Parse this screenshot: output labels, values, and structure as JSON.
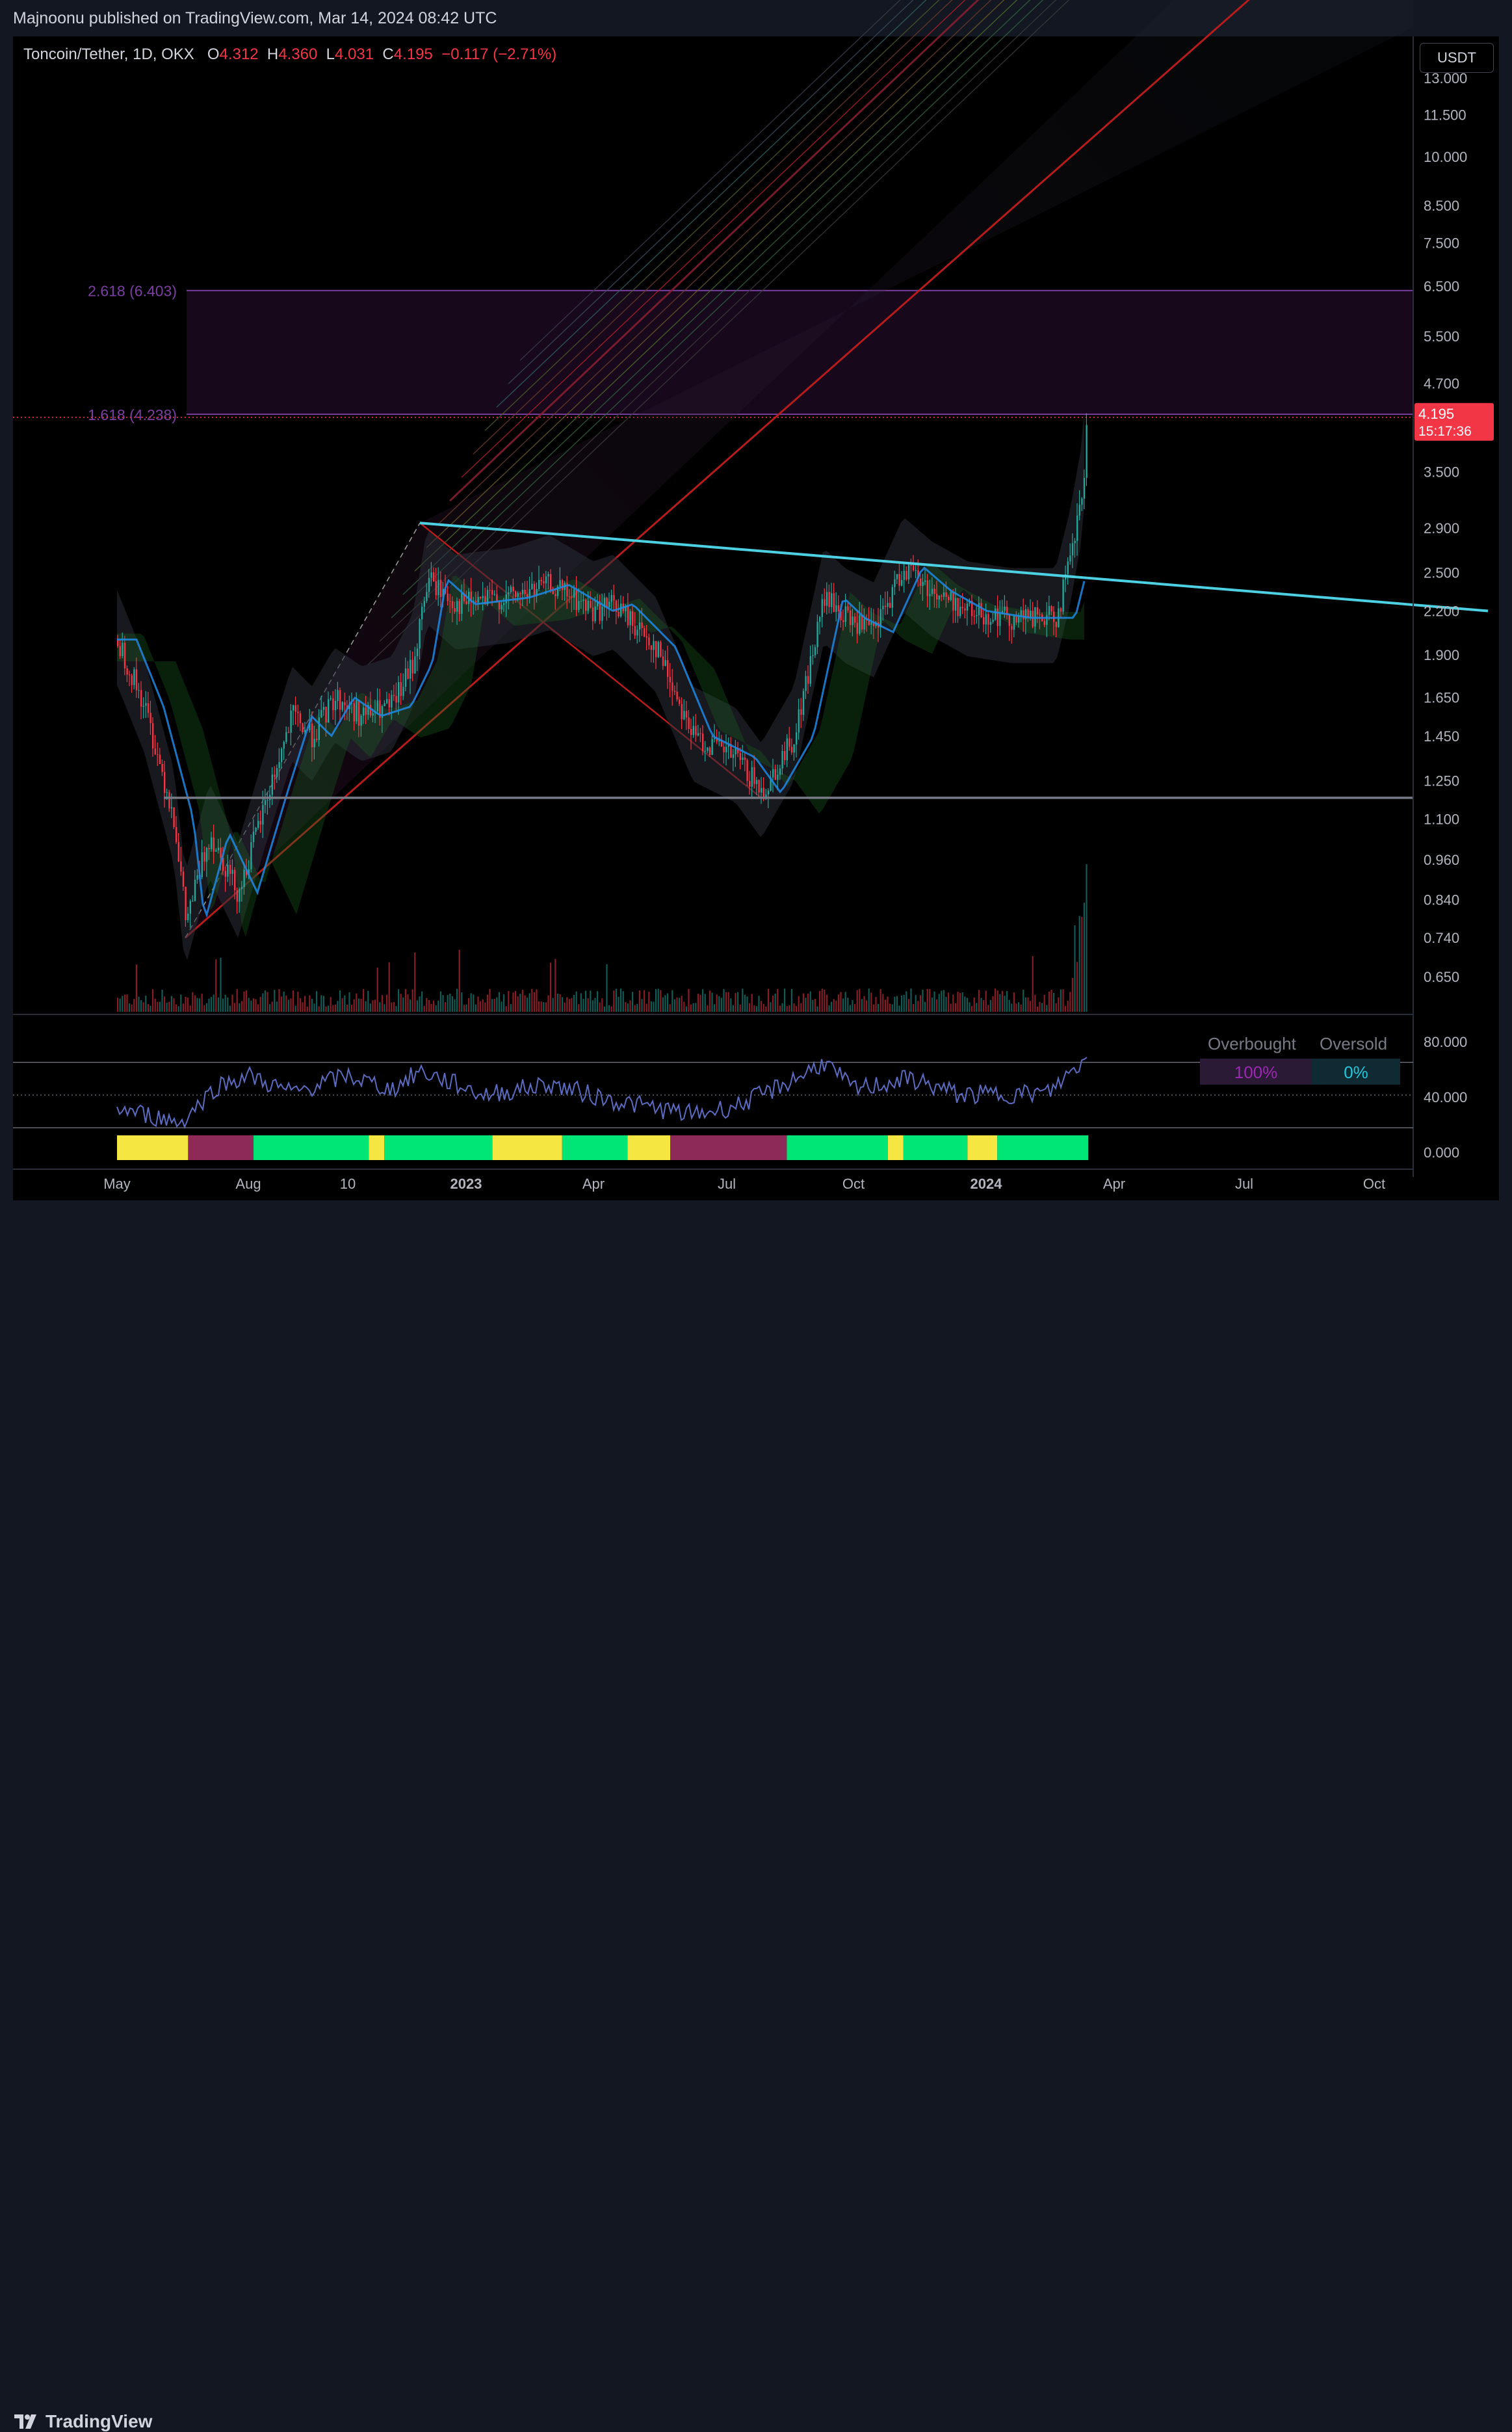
{
  "publisher": "Majnoonu published on TradingView.com, Mar 14, 2024 08:42 UTC",
  "symbol": {
    "name": "Toncoin/Tether, 1D, OKX",
    "o_label": "O",
    "o": "4.312",
    "h_label": "H",
    "h": "4.360",
    "l_label": "L",
    "l": "4.031",
    "c_label": "C",
    "c": "4.195",
    "change": "−0.117 (−2.71%)"
  },
  "currency_button": "USDT",
  "last_price": {
    "value": "4.195",
    "countdown": "15:17:36"
  },
  "fib_levels": [
    {
      "label": "2.618 (6.403)",
      "value": 6.403
    },
    {
      "label": "1.618 (4.238)",
      "value": 4.238
    }
  ],
  "indicator": {
    "overbought_label": "Overbought",
    "oversold_label": "Oversold",
    "overbought_value": "100%",
    "oversold_value": "0%",
    "axis_ticks": [
      "80.000",
      "40.000",
      "0.000"
    ]
  },
  "colors": {
    "up": "#26a69a",
    "down": "#f23645",
    "trendline": "#4dd0e1",
    "fib": "#7b3fa0",
    "rsi": "#7e57c2"
  },
  "chart_data": {
    "type": "candlestick",
    "scale": "log",
    "y_ticks": [
      "13.000",
      "11.500",
      "10.000",
      "8.500",
      "7.500",
      "6.500",
      "5.500",
      "4.700",
      "3.500",
      "2.900",
      "2.500",
      "2.200",
      "1.900",
      "1.650",
      "1.450",
      "1.250",
      "1.100",
      "0.960",
      "0.840",
      "0.740",
      "0.650"
    ],
    "x_ticks": [
      "May",
      "Aug",
      "10",
      "2023",
      "Apr",
      "Jul",
      "Oct",
      "2024",
      "Apr",
      "Jul",
      "Oct"
    ],
    "x_ticks_bold": [
      "2023",
      "2024"
    ],
    "price_path": [
      [
        "2022-05-01",
        2.0
      ],
      [
        "2022-05-20",
        1.6
      ],
      [
        "2022-06-10",
        1.1
      ],
      [
        "2022-06-18",
        0.78
      ],
      [
        "2022-07-05",
        1.05
      ],
      [
        "2022-07-25",
        0.86
      ],
      [
        "2022-08-15",
        1.2
      ],
      [
        "2022-09-01",
        1.55
      ],
      [
        "2022-09-15",
        1.45
      ],
      [
        "2022-10-01",
        1.65
      ],
      [
        "2022-10-20",
        1.55
      ],
      [
        "2022-11-10",
        1.6
      ],
      [
        "2022-11-25",
        1.85
      ],
      [
        "2022-12-05",
        2.45
      ],
      [
        "2022-12-25",
        2.25
      ],
      [
        "2023-02-01",
        2.3
      ],
      [
        "2023-03-01",
        2.4
      ],
      [
        "2023-04-01",
        2.2
      ],
      [
        "2023-04-15",
        2.25
      ],
      [
        "2023-05-15",
        1.95
      ],
      [
        "2023-06-10",
        1.45
      ],
      [
        "2023-07-10",
        1.35
      ],
      [
        "2023-07-28",
        1.2
      ],
      [
        "2023-08-20",
        1.45
      ],
      [
        "2023-09-10",
        2.3
      ],
      [
        "2023-09-25",
        2.15
      ],
      [
        "2023-10-15",
        2.05
      ],
      [
        "2023-11-05",
        2.55
      ],
      [
        "2023-11-25",
        2.35
      ],
      [
        "2023-12-20",
        2.2
      ],
      [
        "2024-01-20",
        2.15
      ],
      [
        "2024-02-20",
        2.15
      ],
      [
        "2024-03-01",
        2.6
      ],
      [
        "2024-03-10",
        3.3
      ],
      [
        "2024-03-13",
        4.195
      ]
    ],
    "trendline": [
      [
        "2022-11-30",
        2.95
      ],
      [
        "2024-12-20",
        2.2
      ]
    ],
    "support_level": 1.18,
    "rsi_range": [
      0,
      100
    ],
    "rsi_path": [
      [
        "2022-05-01",
        38
      ],
      [
        "2022-06-15",
        25
      ],
      [
        "2022-07-10",
        58
      ],
      [
        "2022-08-01",
        68
      ],
      [
        "2022-09-01",
        52
      ],
      [
        "2022-10-10",
        68
      ],
      [
        "2022-11-10",
        55
      ],
      [
        "2022-11-30",
        72
      ],
      [
        "2023-01-15",
        50
      ],
      [
        "2023-03-01",
        60
      ],
      [
        "2023-04-15",
        45
      ],
      [
        "2023-06-10",
        32
      ],
      [
        "2023-07-10",
        40
      ],
      [
        "2023-08-01",
        52
      ],
      [
        "2023-08-25",
        68
      ],
      [
        "2023-09-10",
        80
      ],
      [
        "2023-10-01",
        55
      ],
      [
        "2023-11-10",
        65
      ],
      [
        "2023-12-15",
        50
      ],
      [
        "2024-02-15",
        52
      ],
      [
        "2024-03-05",
        75
      ],
      [
        "2024-03-13",
        83
      ]
    ],
    "heatmap_segments": [
      [
        "2022-05-01",
        "2022-06-20",
        "#f5e642"
      ],
      [
        "2022-06-20",
        "2022-08-05",
        "#8e2a58"
      ],
      [
        "2022-08-05",
        "2022-10-25",
        "#00e676"
      ],
      [
        "2022-10-25",
        "2022-11-05",
        "#f5e642"
      ],
      [
        "2022-11-05",
        "2023-01-20",
        "#00e676"
      ],
      [
        "2023-01-20",
        "2023-03-10",
        "#f5e642"
      ],
      [
        "2023-03-10",
        "2023-04-25",
        "#00e676"
      ],
      [
        "2023-04-25",
        "2023-05-25",
        "#f5e642"
      ],
      [
        "2023-05-25",
        "2023-08-15",
        "#8e2a58"
      ],
      [
        "2023-08-15",
        "2023-10-25",
        "#00e676"
      ],
      [
        "2023-10-25",
        "2023-11-05",
        "#f5e642"
      ],
      [
        "2023-11-05",
        "2023-12-20",
        "#00e676"
      ],
      [
        "2023-12-20",
        "2024-01-10",
        "#f5e642"
      ],
      [
        "2024-01-10",
        "2024-03-14",
        "#00e676"
      ]
    ]
  }
}
